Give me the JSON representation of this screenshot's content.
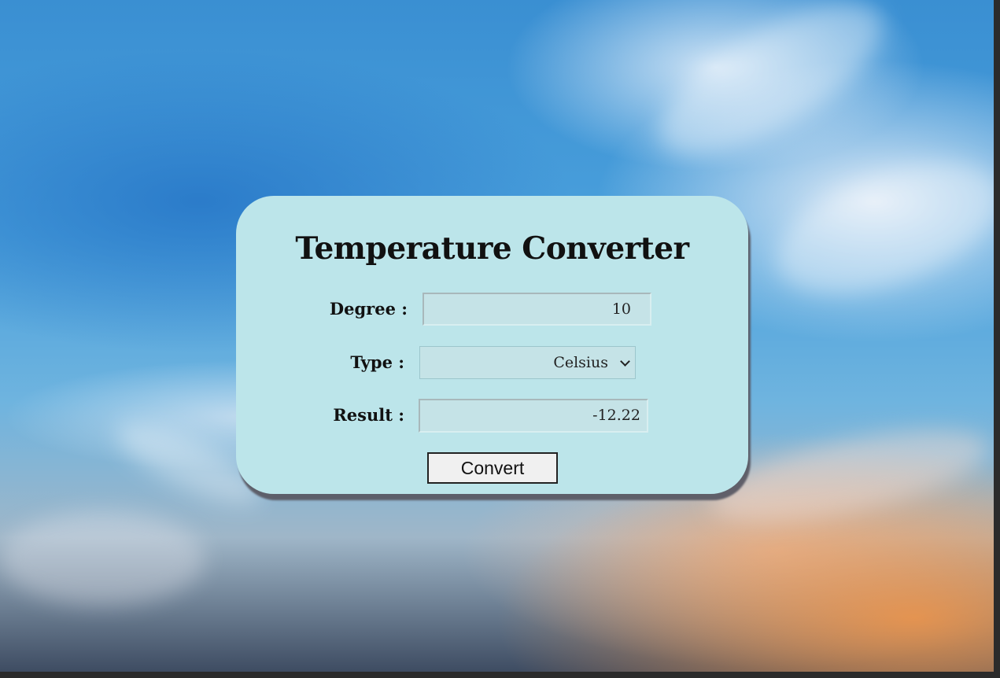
{
  "app": {
    "title": "Temperature Converter"
  },
  "form": {
    "degree_label": "Degree :",
    "degree_value": "10",
    "type_label": "Type :",
    "type_selected": "Celsius",
    "result_label": "Result :",
    "result_value": "-12.22",
    "convert_label": "Convert"
  },
  "icons": {
    "select_arrow": "chevron-down-icon"
  },
  "colors": {
    "card_background": "#bce5ea",
    "field_background": "#c5e3e7",
    "button_background": "#f0f0f0"
  }
}
